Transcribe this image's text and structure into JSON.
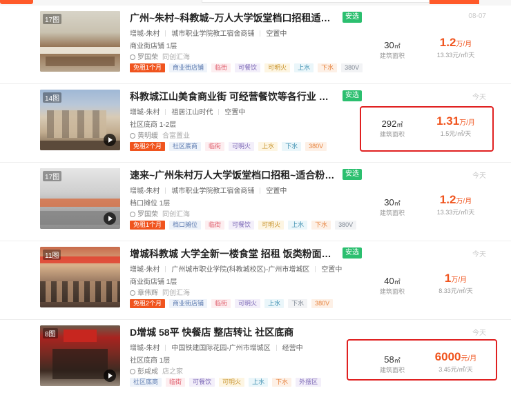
{
  "listings": [
    {
      "photo_count": "17图",
      "title": "广州~朱村~科教城~万人大学饭堂档口招租适合粉面麻…",
      "badge": "安选",
      "date": "08-07",
      "district": "增城-朱村",
      "location": "城市职业学院教工宿舍商铺",
      "status": "空置中",
      "shop_type": "商业街店铺 1层",
      "contact": "罗国荣",
      "contact_note": "同创汇海",
      "tags": [
        "免租1个月",
        "商业街店铺",
        "临街",
        "可餐饮",
        "可明火",
        "上水",
        "下水",
        "380V"
      ],
      "area": "30",
      "area_unit": "㎡",
      "area_label": "建筑面积",
      "price": "1.2",
      "price_unit": "万/月",
      "unit_price": "13.33元/㎡/天"
    },
    {
      "photo_count": "14图",
      "title": "科教城江山美食商业街 可经营餐饮等各行业 租金低 停…",
      "badge": "安选",
      "date": "今天",
      "district": "增城-朱村",
      "location": "祖居江山时代",
      "status": "空置中",
      "shop_type": "社区底商 1-2层",
      "contact": "黄明缓",
      "contact_note": "合富置业",
      "tags": [
        "免租2个月",
        "社区底商",
        "临街",
        "可明火",
        "上水",
        "下水",
        "380V"
      ],
      "area": "292",
      "area_unit": "㎡",
      "area_label": "建筑面积",
      "price": "1.31",
      "price_unit": "万/月",
      "unit_price": "1.5元/㎡/天"
    },
    {
      "photo_count": "17图",
      "title": "速来~广州朱村万人大学饭堂档口招租~适合粉面小吃特…",
      "badge": "安选",
      "date": "今天",
      "district": "增城-朱村",
      "location": "城市职业学院教工宿舍商铺",
      "status": "空置中",
      "shop_type": "档口摊位 1层",
      "contact": "罗国荣",
      "contact_note": "同创汇海",
      "tags": [
        "免租1个月",
        "档口摊位",
        "临街",
        "可餐饮",
        "可明火",
        "上水",
        "下水",
        "380V"
      ],
      "area": "30",
      "area_unit": "㎡",
      "area_label": "建筑面积",
      "price": "1.2",
      "price_unit": "万/月",
      "unit_price": "13.33元/㎡/天"
    },
    {
      "photo_count": "11图",
      "title": "增城科教城 大学全新一楼食堂 招租 饭类粉面茶饮业态…",
      "badge": "安选",
      "date": "今天",
      "district": "增城-朱村",
      "location": "广州城市职业学院(科教城校区)-广州市增城区",
      "status": "空置中",
      "shop_type": "商业街店铺 1层",
      "contact": "章伟辉",
      "contact_note": "同创汇海",
      "tags": [
        "免租2个月",
        "商业街店铺",
        "临街",
        "可明火",
        "上水",
        "下水",
        "380V"
      ],
      "area": "40",
      "area_unit": "㎡",
      "area_label": "建筑面积",
      "price": "1",
      "price_unit": "万/月",
      "unit_price": "8.33元/㎡/天"
    },
    {
      "photo_count": "8图",
      "title": "D增城 58平 快餐店 整店转让 社区底商",
      "badge": "",
      "date": "今天",
      "district": "增城-朱村",
      "location": "中国铁建国际花园-广州市增城区",
      "status": "经营中",
      "shop_type": "社区底商 1层",
      "contact": "彭咸成",
      "contact_note": "店之家",
      "tags": [
        "社区底商",
        "临街",
        "可餐饮",
        "可明火",
        "上水",
        "下水",
        "外摆区"
      ],
      "area": "58",
      "area_unit": "㎡",
      "area_label": "建筑面积",
      "price": "6000",
      "price_unit": "元/月",
      "unit_price": "3.45元/㎡/天"
    }
  ],
  "colors": {
    "accent": "#f0541e",
    "select_badge": "#2bbf6f",
    "highlight_box": "#e02020"
  }
}
